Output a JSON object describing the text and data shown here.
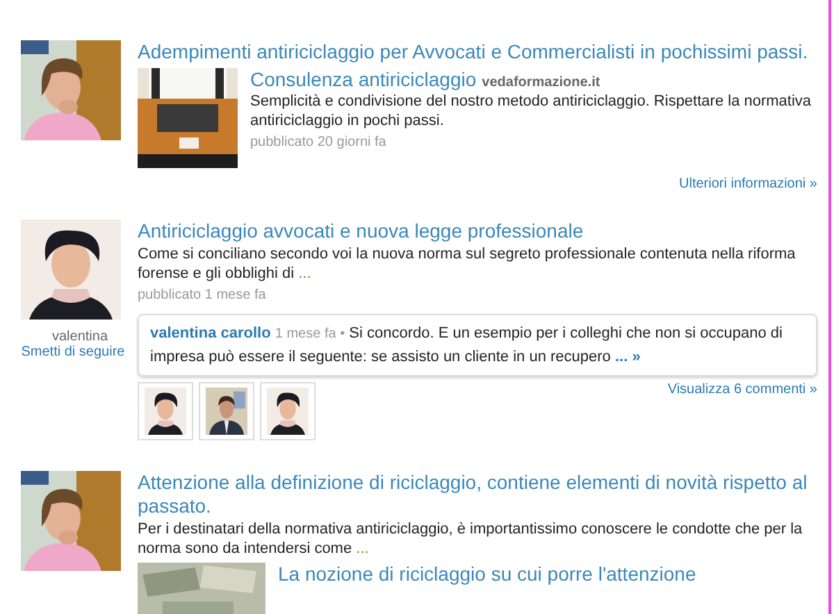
{
  "posts": [
    {
      "title": "Adempimenti antiriciclaggio per Avvocati e Commercialisti in pochissimi passi.",
      "share": {
        "title": "Consulenza antiriciclaggio",
        "source": "vedaformazione.it",
        "text": "Semplicità e condivisione del nostro metodo antiriciclaggio. Rispettare la normativa antiriciclaggio in pochi passi.",
        "meta": "pubblicato 20 giorni fa"
      },
      "more_link": "Ulteriori informazioni »"
    },
    {
      "author": "valentina",
      "unfollow": "Smetti di seguire",
      "title": "Antiriciclaggio avvocati e nuova legge professionale",
      "text": "Come si conciliano secondo voi la nuova norma sul segreto professionale contenuta nella riforma forense e gli obblighi di",
      "ellipsis": "...",
      "meta": "pubblicato 1 mese fa",
      "comment": {
        "author": "valentina carollo",
        "time": "1 mese fa",
        "bullet": "•",
        "text": "Si concordo. E un esempio per i colleghi che non si occupano di impresa può essere il seguente: se assisto un cliente in un recupero",
        "more": "... »"
      },
      "comments_link": "Visualizza 6 commenti »"
    },
    {
      "title": "Attenzione alla definizione di riciclaggio, contiene elementi di novità rispetto al passato.",
      "text": "Per i destinatari della normativa antiriciclaggio, è importantissimo conoscere le condotte che per la norma sono da intendersi come",
      "ellipsis": "...",
      "share": {
        "title": "La nozione di riciclaggio su cui porre l'attenzione"
      }
    }
  ]
}
